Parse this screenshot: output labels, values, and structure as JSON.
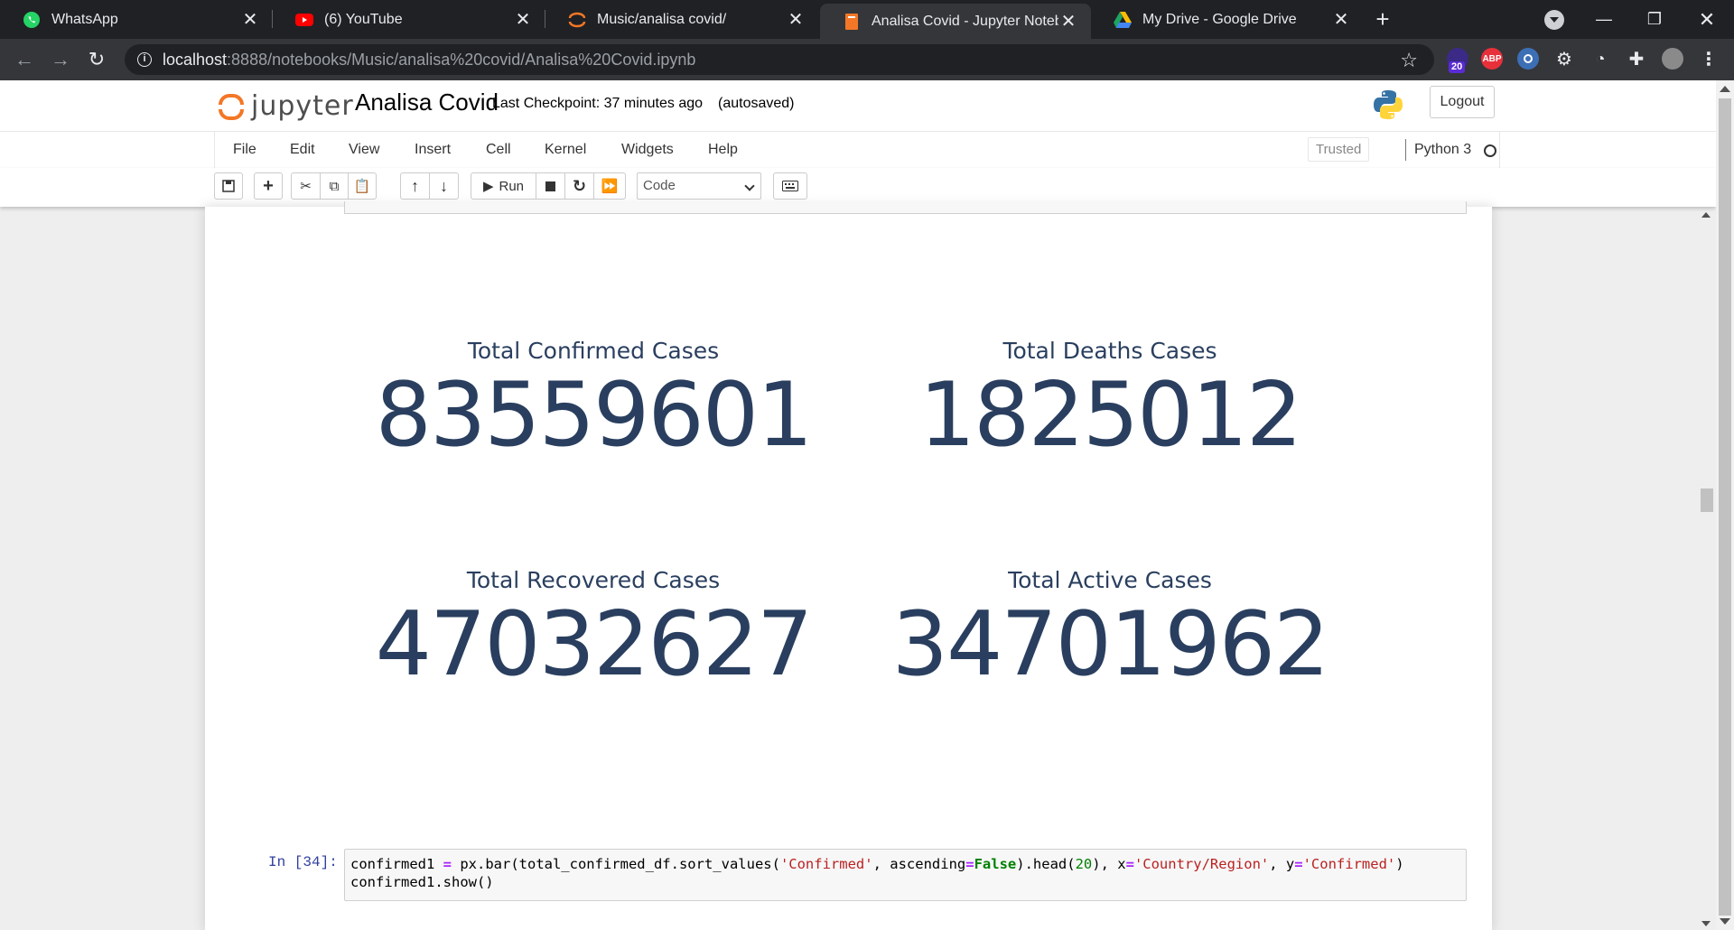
{
  "browser": {
    "tabs": [
      {
        "title": "WhatsApp",
        "icon": "whatsapp-icon"
      },
      {
        "title": "(6) YouTube",
        "icon": "youtube-icon"
      },
      {
        "title": "Music/analisa covid/",
        "icon": "jupyter-icon"
      },
      {
        "title": "Analisa Covid - Jupyter Notebook",
        "icon": "notebook-icon",
        "active": true
      },
      {
        "title": "My Drive - Google Drive",
        "icon": "google-drive-icon"
      }
    ],
    "new_tab": "+",
    "url_host": "localhost",
    "url_path": ":8888/notebooks/Music/analisa%20covid/Analisa%20Covid.ipynb",
    "extension_badge": "20",
    "abp_label": "ABP"
  },
  "jupyter": {
    "logo_text": "jupyter",
    "notebook_name": "Analisa Covid",
    "checkpoint": "Last Checkpoint: 37 minutes ago",
    "autosaved": "(autosaved)",
    "logout": "Logout",
    "menu": [
      "File",
      "Edit",
      "View",
      "Insert",
      "Cell",
      "Kernel",
      "Widgets",
      "Help"
    ],
    "trusted": "Trusted",
    "kernel": "Python 3",
    "run_label": "Run",
    "cell_type": "Code"
  },
  "output": {
    "confirmed_label": "Total Confirmed Cases",
    "confirmed_value": "83559601",
    "deaths_label": "Total Deaths Cases",
    "deaths_value": "1825012",
    "recovered_label": "Total Recovered Cases",
    "recovered_value": "47032627",
    "active_label": "Total Active Cases",
    "active_value": "34701962"
  },
  "code_cell": {
    "prompt": "In [34]:",
    "line1_parts": [
      "confirmed1 ",
      "= ",
      "px.bar(total_confirmed_df.sort_values(",
      "'Confirmed'",
      ", ascending",
      "=",
      "False",
      ").head(",
      "20",
      "), x",
      "=",
      "'Country/Region'",
      ", y",
      "=",
      "'Confirmed'",
      ")"
    ],
    "line2": "confirmed1.show()"
  },
  "colors": {
    "accent_orange": "#f37726",
    "stat_text": "#2a3f5f",
    "prompt_blue": "#303f9f"
  }
}
